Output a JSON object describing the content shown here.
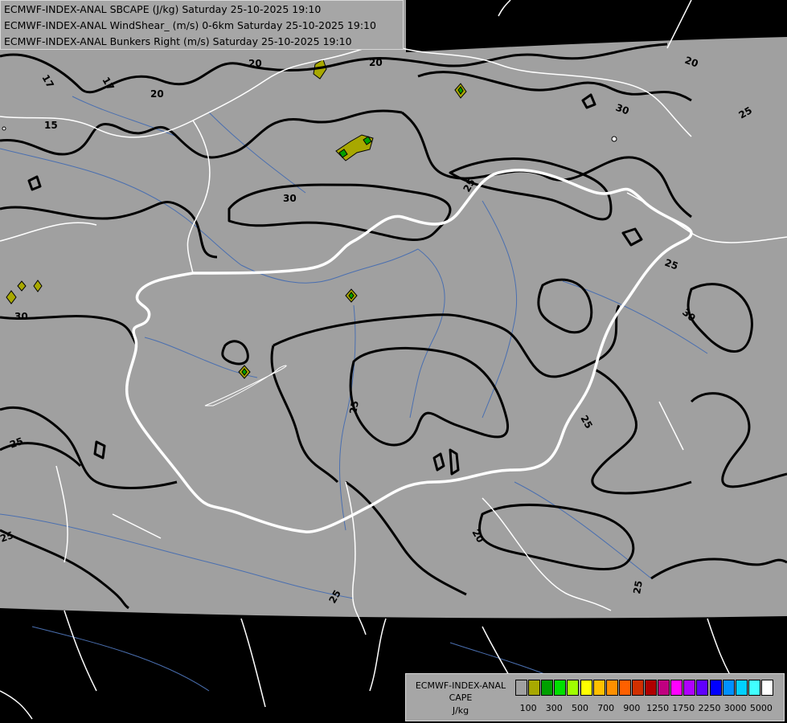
{
  "titles": {
    "line1": "ECMWF-INDEX-ANAL SBCAPE (J/kg) Saturday 25-10-2025 19:10",
    "line2": "ECMWF-INDEX-ANAL WindShear_ (m/s) 0-6km Saturday 25-10-2025 19:10",
    "line3": "ECMWF-INDEX-ANAL Bunkers Right (m/s) Saturday 25-10-2025 19:10"
  },
  "legend": {
    "title_line1": "ECMWF-INDEX-ANAL",
    "title_line2": "CAPE",
    "title_line3": "J/kg",
    "swatches": [
      "#a0a0a0",
      "#a8a800",
      "#00a000",
      "#00e000",
      "#a0ff00",
      "#ffff00",
      "#ffc000",
      "#ff9000",
      "#ff6000",
      "#d03000",
      "#b00000",
      "#c00080",
      "#ff00ff",
      "#b000ff",
      "#6000ff",
      "#0000ff",
      "#0090ff",
      "#00d0ff",
      "#40ffff",
      "#ffffff"
    ],
    "ticks": [
      "100",
      "300",
      "500",
      "700",
      "900",
      "1250",
      "1750",
      "2250",
      "3000",
      "5000"
    ]
  },
  "contour_labels": [
    "17",
    "17",
    "20",
    "20",
    "20",
    "20",
    "15",
    "30",
    "30",
    "30",
    "25",
    "25",
    "25",
    "25",
    "25",
    "25",
    "25",
    "20",
    "25",
    "25",
    "30"
  ],
  "colors": {
    "background": "#000000",
    "domain_fill": "#a0a0a0",
    "contour": "#000000",
    "country_border": "#ffffff",
    "rivers": "#4a6fb0",
    "cape_low": "#a8a800",
    "cape_mid": "#00a000"
  }
}
